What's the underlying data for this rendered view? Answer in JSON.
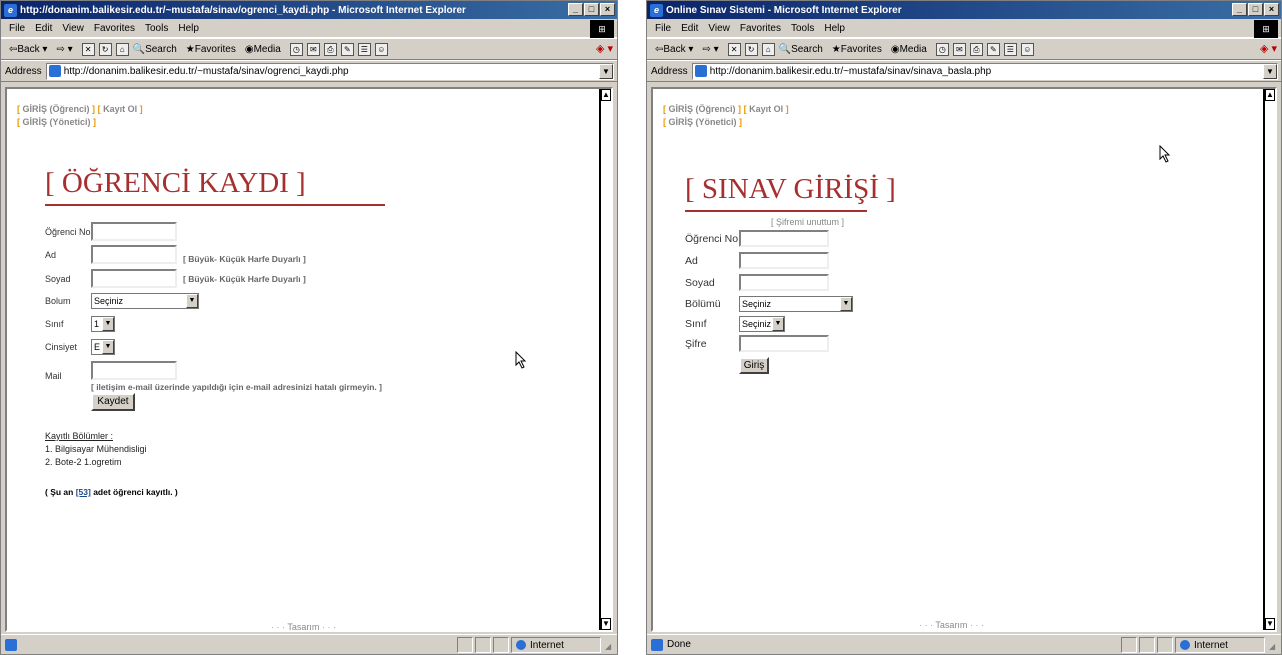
{
  "left_window": {
    "title": "http://donanim.balikesir.edu.tr/~mustafa/sinav/ogrenci_kaydi.php - Microsoft Internet Explorer",
    "address": "http://donanim.balikesir.edu.tr/~mustafa/sinav/ogrenci_kaydi.php",
    "status_text": "",
    "nav": {
      "login_student": "GİRİŞ (Öğrenci)",
      "register": "Kayıt Ol",
      "login_admin": "GİRİŞ (Yönetici)"
    },
    "page_title": "[ ÖĞRENCİ KAYDI ]",
    "fields": {
      "student_no_label": "Öğrenci No",
      "name_label": "Ad",
      "name_hint": "[ Büyük- Küçük Harfe Duyarlı ]",
      "surname_label": "Soyad",
      "surname_hint": "[ Büyük- Küçük Harfe Duyarlı ]",
      "department_label": "Bolum",
      "department_value": "Seçiniz",
      "class_label": "Sınıf",
      "class_value": "1",
      "gender_label": "Cinsiyet",
      "gender_value": "E",
      "mail_label": "Mail",
      "mail_hint": "[ iletişim e-mail üzerinde yapıldığı için e-mail adresinizi hatalı girmeyin. ]",
      "submit_label": "Kaydet"
    },
    "departments_header": "Kayıtlı Bölümler :",
    "departments": [
      "1. Bilgisayar Mühendisligi",
      "2. Bote-2 1.ogretim"
    ],
    "count_prefix": "( Şu an ",
    "count_value": "[53]",
    "count_suffix": " adet öğrenci kayıtlı. )",
    "footer": "Tasarım"
  },
  "right_window": {
    "title": "Online Sınav Sistemi - Microsoft Internet Explorer",
    "address": "http://donanim.balikesir.edu.tr/~mustafa/sinav/sinava_basla.php",
    "status_text": "Done",
    "nav": {
      "login_student": "GİRİŞ (Öğrenci)",
      "register": "Kayıt Ol",
      "login_admin": "GİRİŞ (Yönetici)"
    },
    "page_title": "[ SINAV GİRİŞİ ]",
    "forgot_password": "[ Şifremi unuttum ]",
    "fields": {
      "student_no_label": "Öğrenci No",
      "name_label": "Ad",
      "surname_label": "Soyad",
      "department_label": "Bölümü",
      "department_value": "Seçiniz",
      "class_label": "Sınıf",
      "class_value": "Seçiniz",
      "password_label": "Şifre",
      "submit_label": "Giriş"
    },
    "footer": "Tasarım"
  },
  "browser": {
    "menu": [
      "File",
      "Edit",
      "View",
      "Favorites",
      "Tools",
      "Help"
    ],
    "toolbar": {
      "back": "Back",
      "search": "Search",
      "favorites": "Favorites",
      "media": "Media"
    },
    "address_label": "Address",
    "zone": "Internet"
  }
}
